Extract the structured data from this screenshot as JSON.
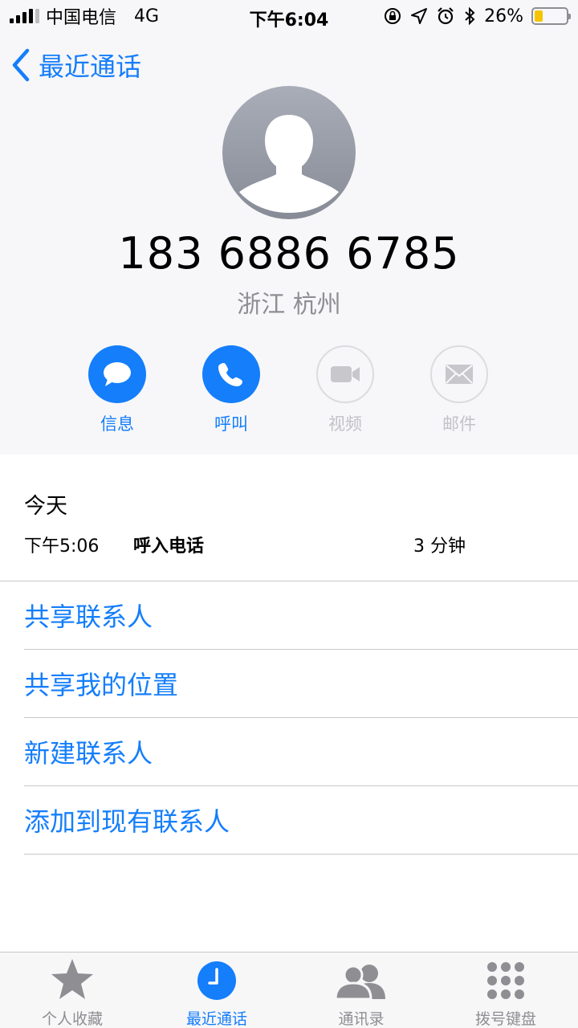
{
  "status_bar": {
    "carrier": "中国电信",
    "network": "4G",
    "time": "下午6:04",
    "battery": "26%",
    "battery_level": 0.26
  },
  "nav": {
    "back_label": "最近通话"
  },
  "contact": {
    "phone": "183 6886 6785",
    "location": "浙江 杭州"
  },
  "actions": [
    {
      "label": "信息",
      "icon": "message-icon",
      "enabled": true
    },
    {
      "label": "呼叫",
      "icon": "phone-icon",
      "enabled": true
    },
    {
      "label": "视频",
      "icon": "video-icon",
      "enabled": false
    },
    {
      "label": "邮件",
      "icon": "mail-icon",
      "enabled": false
    }
  ],
  "call_log": {
    "date": "今天",
    "entries": [
      {
        "time": "下午5:06",
        "type": "呼入电话",
        "duration": "3 分钟"
      }
    ]
  },
  "menu": [
    {
      "label": "共享联系人"
    },
    {
      "label": "共享我的位置"
    },
    {
      "label": "新建联系人"
    },
    {
      "label": "添加到现有联系人"
    }
  ],
  "tabs": [
    {
      "label": "个人收藏",
      "icon": "star-icon",
      "active": false
    },
    {
      "label": "最近通话",
      "icon": "clock-icon",
      "active": true
    },
    {
      "label": "通讯录",
      "icon": "contacts-icon",
      "active": false
    },
    {
      "label": "拨号键盘",
      "icon": "keypad-icon",
      "active": false
    }
  ],
  "colors": {
    "accent": "#147efb",
    "disabled": "#c2c2c7",
    "battery_fill": "#f5c400"
  }
}
